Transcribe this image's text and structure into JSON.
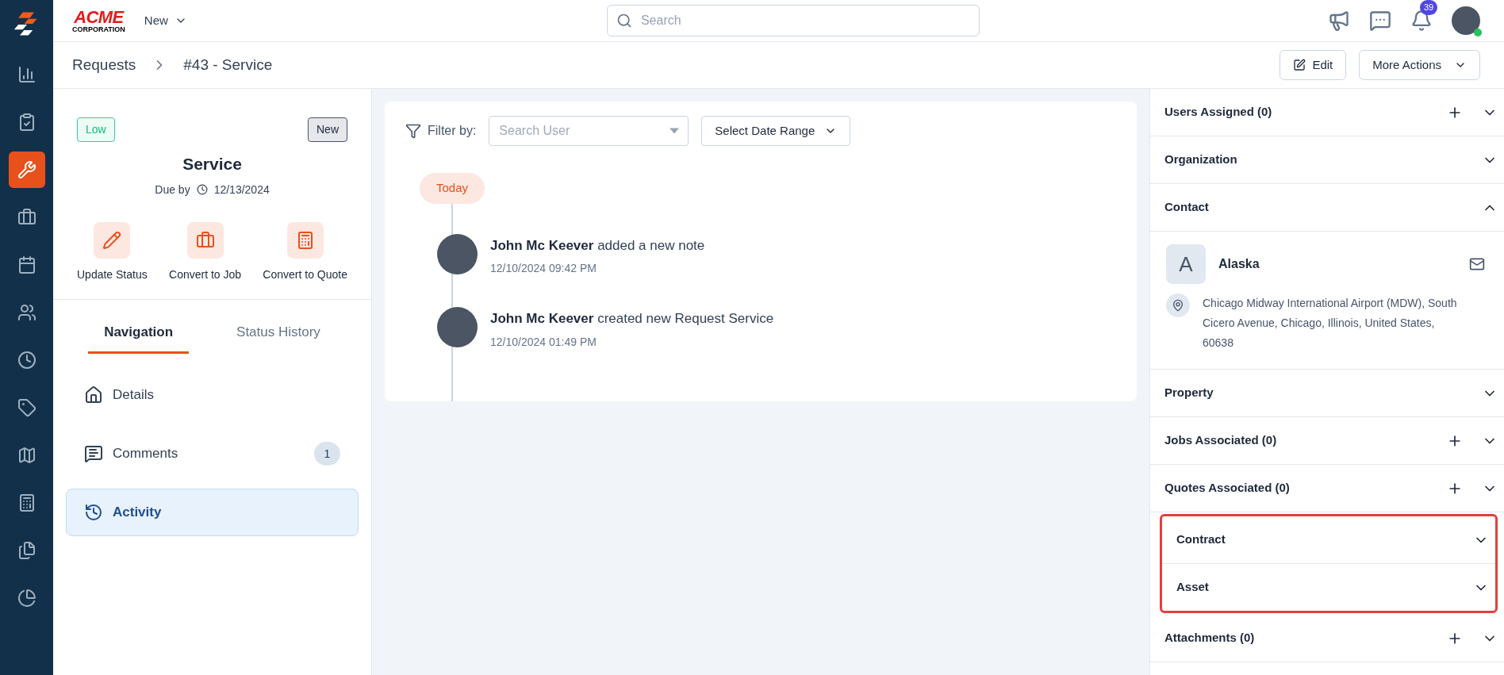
{
  "sidebar": {
    "items": [
      {
        "selected": false
      },
      {
        "selected": false
      },
      {
        "selected": true
      },
      {
        "selected": false
      },
      {
        "selected": false
      },
      {
        "selected": false
      },
      {
        "selected": false
      },
      {
        "selected": false
      },
      {
        "selected": false
      },
      {
        "selected": false
      },
      {
        "selected": false
      },
      {
        "selected": false
      }
    ]
  },
  "topbar": {
    "logo": {
      "name": "ACME",
      "sub": "CORPORATION"
    },
    "new_menu": "New",
    "search": {
      "placeholder": "Search"
    },
    "notifications": "39",
    "user": {
      "online": true
    }
  },
  "breadcrumb": [
    "Requests",
    "#43 - Service"
  ],
  "header_buttons": [
    {
      "label": "Edit",
      "kind": "edit"
    },
    {
      "label": "More Actions",
      "kind": "menu"
    }
  ],
  "request": {
    "priority": "Low",
    "status": "New",
    "title": "Service",
    "due_label": "Due by",
    "due_date": "12/13/2024",
    "actions": [
      {
        "label": "Update Status"
      },
      {
        "label": "Convert to Job"
      },
      {
        "label": "Convert to Quote"
      }
    ]
  },
  "tabs": [
    {
      "label": "Navigation",
      "selected": true
    },
    {
      "label": "Status History",
      "selected": false
    }
  ],
  "nav": [
    {
      "label": "Details",
      "selected": false
    },
    {
      "label": "Comments",
      "count": "1",
      "selected": false
    },
    {
      "label": "Activity",
      "selected": true
    }
  ],
  "activity": {
    "filter_label": "Filter by:",
    "user_field": {
      "placeholder": "Search User"
    },
    "date_range": "Select Date Range",
    "day": "Today",
    "entries": [
      {
        "actor": "John Mc Keever",
        "action": "added a new note",
        "time": "12/10/2024 09:42 PM"
      },
      {
        "actor": "John Mc Keever",
        "action": "created new Request Service",
        "time": "12/10/2024 01:49 PM"
      }
    ]
  },
  "sections": [
    {
      "title": "Users Assigned (0)",
      "addable": true,
      "expanded": false,
      "highlighted": false
    },
    {
      "title": "Organization",
      "addable": false,
      "expanded": false,
      "highlighted": false
    },
    {
      "title": "Contact",
      "addable": false,
      "expanded": true,
      "highlighted": false,
      "contact": {
        "initial": "A",
        "name": "Alaska",
        "address": "Chicago Midway International Airport (MDW), South Cicero Avenue, Chicago, Illinois, United States, 60638"
      }
    },
    {
      "title": "Property",
      "addable": false,
      "expanded": false,
      "highlighted": false
    },
    {
      "title": "Jobs Associated (0)",
      "addable": true,
      "expanded": false,
      "highlighted": false
    },
    {
      "title": "Quotes Associated (0)",
      "addable": true,
      "expanded": false,
      "highlighted": false
    },
    {
      "title": "Contract",
      "addable": false,
      "expanded": false,
      "highlighted": true
    },
    {
      "title": "Asset",
      "addable": false,
      "expanded": false,
      "highlighted": true
    },
    {
      "title": "Attachments (0)",
      "addable": true,
      "expanded": false,
      "highlighted": false
    }
  ]
}
